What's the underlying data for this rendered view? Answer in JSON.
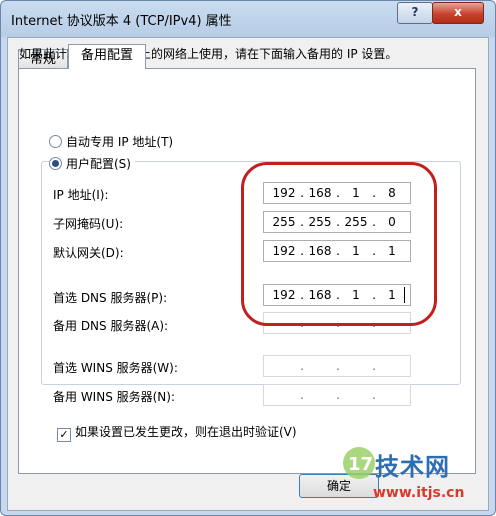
{
  "window": {
    "title": "Internet 协议版本 4 (TCP/IPv4) 属性",
    "help_label": "?",
    "close_label": "x"
  },
  "tabs": [
    {
      "label": "常规"
    },
    {
      "label": "备用配置"
    }
  ],
  "description": "如果此计算机在一个以上的网络上使用，请在下面输入备用的 IP 设置。",
  "radios": {
    "apipa": {
      "label": "自动专用 IP 地址(T)",
      "selected": false
    },
    "user_config": {
      "label": "用户配置(S)",
      "selected": true
    }
  },
  "fields": [
    {
      "label": "IP 地址(I):",
      "octets": [
        "192",
        "168",
        "1",
        "8"
      ]
    },
    {
      "label": "子网掩码(U):",
      "octets": [
        "255",
        "255",
        "255",
        "0"
      ]
    },
    {
      "label": "默认网关(D):",
      "octets": [
        "192",
        "168",
        "1",
        "1"
      ]
    },
    {
      "label": "首选 DNS 服务器(P):",
      "octets": [
        "192",
        "168",
        "1",
        "1"
      ]
    },
    {
      "label": "备用 DNS 服务器(A):",
      "octets": [
        "",
        "",
        "",
        ""
      ]
    },
    {
      "label": "首选 WINS 服务器(W):",
      "octets": [
        "",
        "",
        "",
        ""
      ]
    },
    {
      "label": "备用 WINS 服务器(N):",
      "octets": [
        "",
        "",
        "",
        ""
      ]
    }
  ],
  "validate_checkbox": {
    "label": "如果设置已发生更改，则在退出时验证(V)",
    "checked": true,
    "mark": "✓"
  },
  "ok_button": {
    "label": "确定"
  },
  "watermark": {
    "brand": "技术网",
    "url": "www.itjs.cn"
  },
  "colors": {
    "highlight_circle": "#c21f1f",
    "title_bar": "#b7cde6"
  }
}
